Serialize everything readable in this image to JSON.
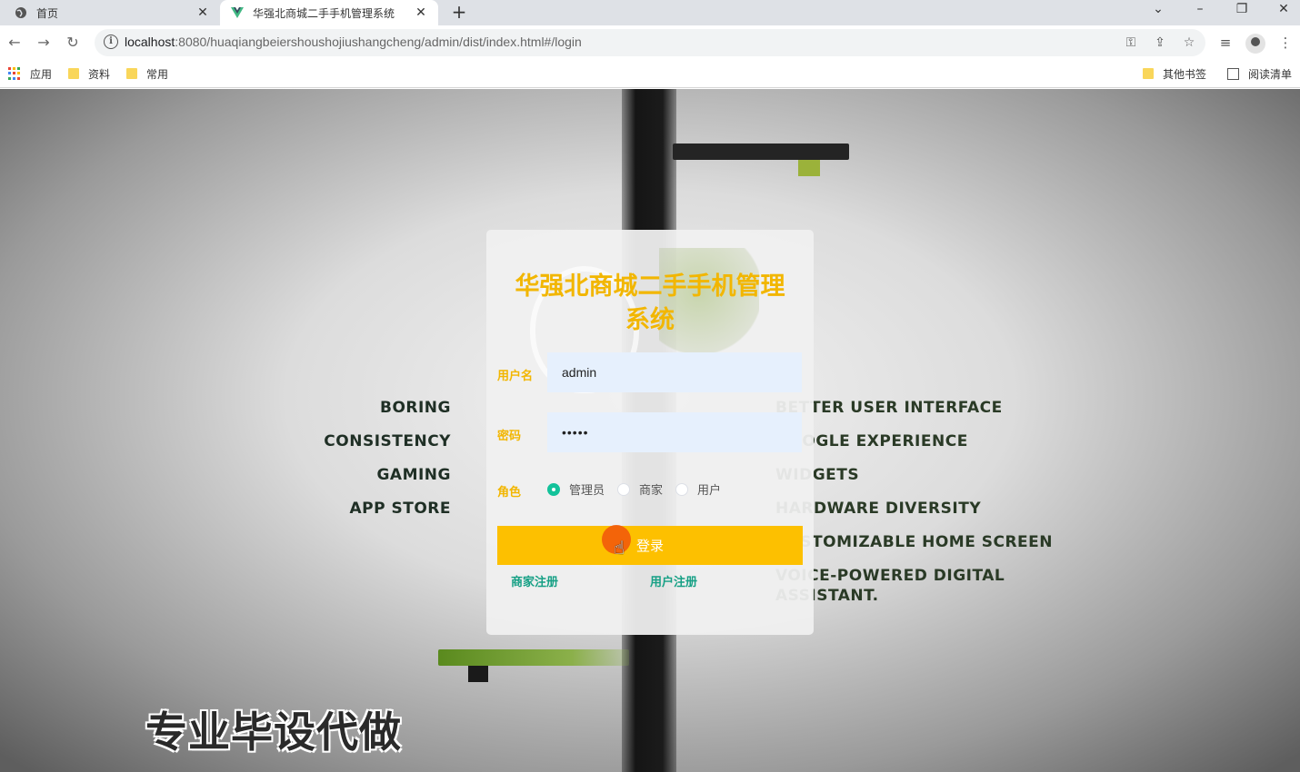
{
  "browser": {
    "tabs": [
      {
        "label": "首页",
        "icon": "globe-icon"
      },
      {
        "label": "华强北商城二手手机管理系统",
        "icon": "vue-logo-icon"
      }
    ],
    "url_host": "localhost",
    "url_rest": ":8080/huaqiangbeiershoushojiushangcheng/admin/dist/index.html#/login",
    "bookmarks": {
      "apps": "应用",
      "items": [
        "资料",
        "常用"
      ],
      "other": "其他书签",
      "reading_list": "阅读清单"
    }
  },
  "background": {
    "left_words": [
      "BORING",
      "CONSISTENCY",
      "GAMING",
      "APP STORE"
    ],
    "right_words": [
      "BETTER USER INTERFACE",
      "GOOGLE EXPERIENCE",
      "WIDGETS",
      "HARDWARE DIVERSITY",
      "CUSTOMIZABLE HOME SCREEN",
      "VOICE-POWERED DIGITAL ASSISTANT."
    ],
    "watermark": "专业毕设代做"
  },
  "login": {
    "title": "华强北商城二手手机管理系统",
    "username_label": "用户名",
    "username_value": "admin",
    "password_label": "密码",
    "password_value": "•••••",
    "role_label": "角色",
    "roles": [
      "管理员",
      "商家",
      "用户"
    ],
    "selected_role": "管理员",
    "login_button": "登录",
    "merchant_register": "商家注册",
    "user_register": "用户注册"
  },
  "colors": {
    "title": "#f2b600",
    "button": "#fdc000",
    "link": "#16a085",
    "radio_checked": "#13c29a",
    "input_bg": "#e6f0fd"
  }
}
